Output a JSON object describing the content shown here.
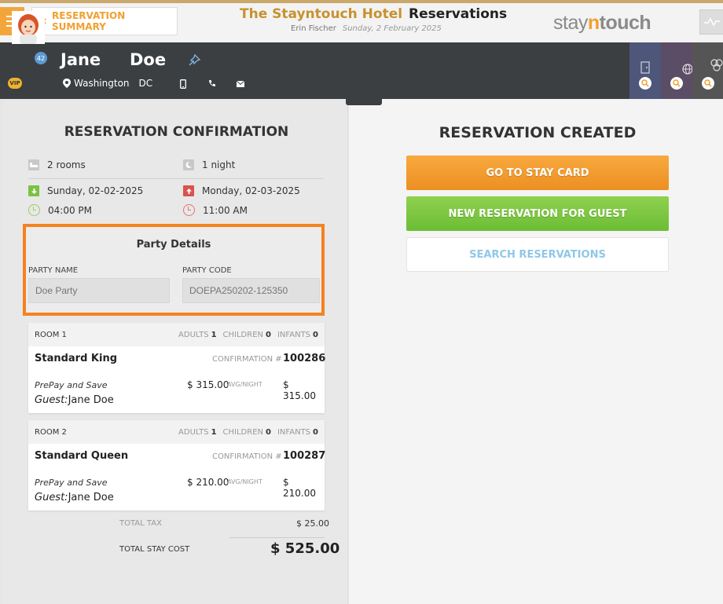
{
  "header": {
    "back_label": "RESERVATION SUMMARY",
    "hotel_name": "The Stayntouch Hotel",
    "page_name": "Reservations",
    "user_name": "Erin Fischer",
    "date": "Sunday, 2 February 2025",
    "logo": {
      "left": "stay",
      "mid": "n",
      "right": "touch"
    }
  },
  "guest": {
    "first_name": "Jane",
    "last_name": "Doe",
    "reservation_count": "42",
    "vip_label": "VIP",
    "city": "Washington",
    "state": "DC"
  },
  "confirmation": {
    "title": "RESERVATION CONFIRMATION",
    "rooms": "2 rooms",
    "nights": "1 night",
    "arrival_date": "Sunday, 02-02-2025",
    "departure_date": "Monday, 02-03-2025",
    "arrival_time": "04:00 PM",
    "departure_time": "11:00 AM"
  },
  "party": {
    "title": "Party Details",
    "name_label": "PARTY NAME",
    "name_placeholder": "Doe Party",
    "code_label": "PARTY CODE",
    "code_placeholder": "DOEPA250202-125350"
  },
  "occupancy_labels": {
    "adults": "ADULTS",
    "children": "CHILDREN",
    "infants": "INFANTS"
  },
  "labels": {
    "confirmation_no": "CONFIRMATION #",
    "avg_night": "AVG/NIGHT",
    "guest": "Guest:"
  },
  "rooms": [
    {
      "title": "ROOM 1",
      "adults": "1",
      "children": "0",
      "infants": "0",
      "type": "Standard King",
      "confirmation": "100286",
      "rate_name": "PrePay and Save",
      "rate": "$ 315.00",
      "total": "$ 315.00",
      "guest": "Jane Doe"
    },
    {
      "title": "ROOM 2",
      "adults": "1",
      "children": "0",
      "infants": "0",
      "type": "Standard Queen",
      "confirmation": "100287",
      "rate_name": "PrePay and Save",
      "rate": "$ 210.00",
      "total": "$ 210.00",
      "guest": "Jane Doe"
    }
  ],
  "totals": {
    "tax_label": "TOTAL TAX",
    "tax": "$ 25.00",
    "stay_label": "TOTAL STAY COST",
    "stay": "$ 525.00"
  },
  "created": {
    "title": "RESERVATION CREATED",
    "stay_card_btn": "GO TO STAY CARD",
    "new_res_btn": "NEW RESERVATION FOR GUEST",
    "search_btn": "SEARCH RESERVATIONS"
  },
  "colors": {
    "accent": "#f0a030",
    "highlight": "#f58220",
    "green": "#7bc142",
    "red": "#d9534f"
  }
}
